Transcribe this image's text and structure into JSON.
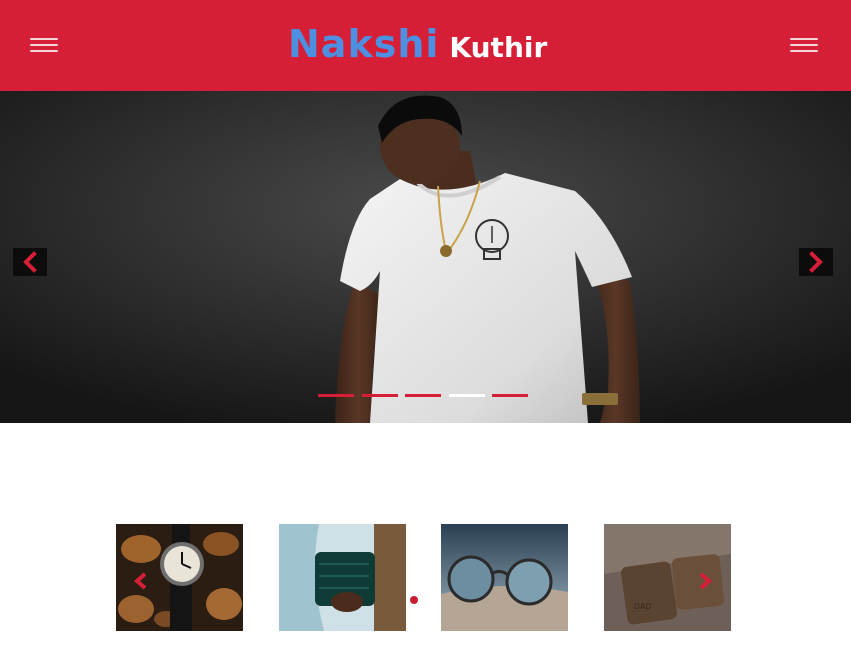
{
  "brand": {
    "word1": "Nakshi",
    "word2": "Kuthir",
    "word1_color": "#4d8fe0",
    "word2_color": "#ffffff"
  },
  "colors": {
    "header_bg": "#d61f37",
    "accent": "#d61f37",
    "hero_bg": "#2f2f2f"
  },
  "header": {
    "left_menu_icon": "hamburger-icon",
    "right_menu_icon": "hamburger-icon"
  },
  "hero": {
    "prev_icon": "chevron-left-icon",
    "next_icon": "chevron-right-icon",
    "slide_count": 5,
    "active_slide": 4
  },
  "products": [
    {
      "name": "watch",
      "icon": "watch-image"
    },
    {
      "name": "wallet",
      "icon": "clutch-wallet-image"
    },
    {
      "name": "sunglasses",
      "icon": "sunglasses-image"
    },
    {
      "name": "leather-wallets",
      "icon": "leather-wallet-image"
    }
  ],
  "product_carousel": {
    "prev_icon": "chevron-left-icon",
    "next_icon": "chevron-right-icon"
  }
}
